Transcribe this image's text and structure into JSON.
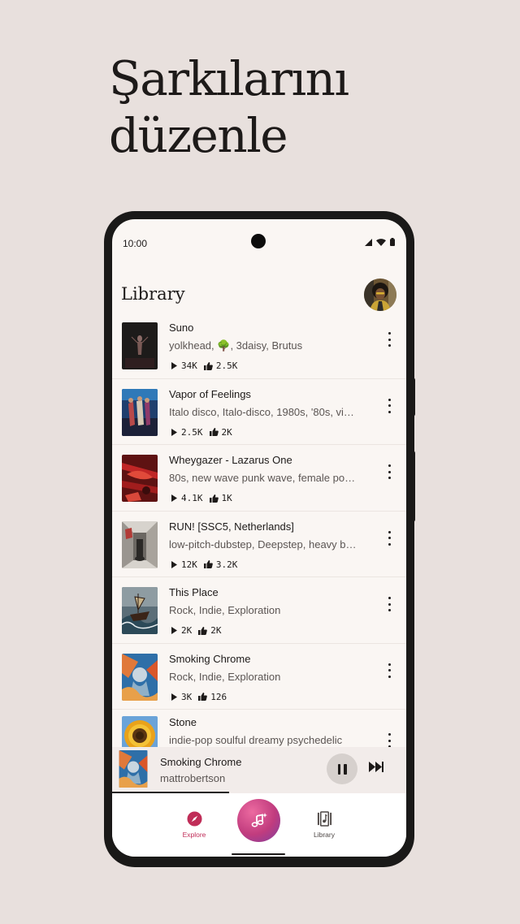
{
  "headline": {
    "line1": "Şarkılarını",
    "line2": "düzenle"
  },
  "statusbar": {
    "time": "10:00"
  },
  "library": {
    "title": "Library",
    "songs": [
      {
        "title": "Suno",
        "tags": "yolkhead, 🌳, 3daisy, Brutus",
        "plays": "34K",
        "likes": "2.5K",
        "cover": "dark-figure"
      },
      {
        "title": "Vapor of Feelings",
        "tags": "Italo disco,  Italo-disco,  1980s,  '80s,  vi…",
        "plays": "2.5K",
        "likes": "2K",
        "cover": "disco-street"
      },
      {
        "title": "Wheygazer - Lazarus One",
        "tags": "80s,  new wave punk wave,  female po…",
        "plays": "4.1K",
        "likes": "1K",
        "cover": "red-dragons"
      },
      {
        "title": "RUN! [SSC5, Netherlands]",
        "tags": "low-pitch-dubstep,  Deepstep,  heavy b…",
        "plays": "12K",
        "likes": "3.2K",
        "cover": "corridor"
      },
      {
        "title": "This Place",
        "tags": "Rock, Indie, Exploration",
        "plays": "2K",
        "likes": "2K",
        "cover": "ship-storm"
      },
      {
        "title": "Smoking Chrome",
        "tags": "Rock, Indie, Exploration",
        "plays": "3K",
        "likes": "126",
        "cover": "chrome-figure"
      },
      {
        "title": "Stone",
        "tags": "indie-pop soulful dreamy psychedelic",
        "plays": "",
        "likes": "",
        "cover": "sunflower"
      }
    ]
  },
  "now_playing": {
    "title": "Smoking Chrome",
    "artist": "mattrobertson",
    "progress": 0.4
  },
  "nav": {
    "explore": "Explore",
    "library": "Library",
    "active": "explore"
  },
  "colors": {
    "accent": "#c02d58",
    "background": "#e8e0dd",
    "screen": "#faf6f3"
  }
}
